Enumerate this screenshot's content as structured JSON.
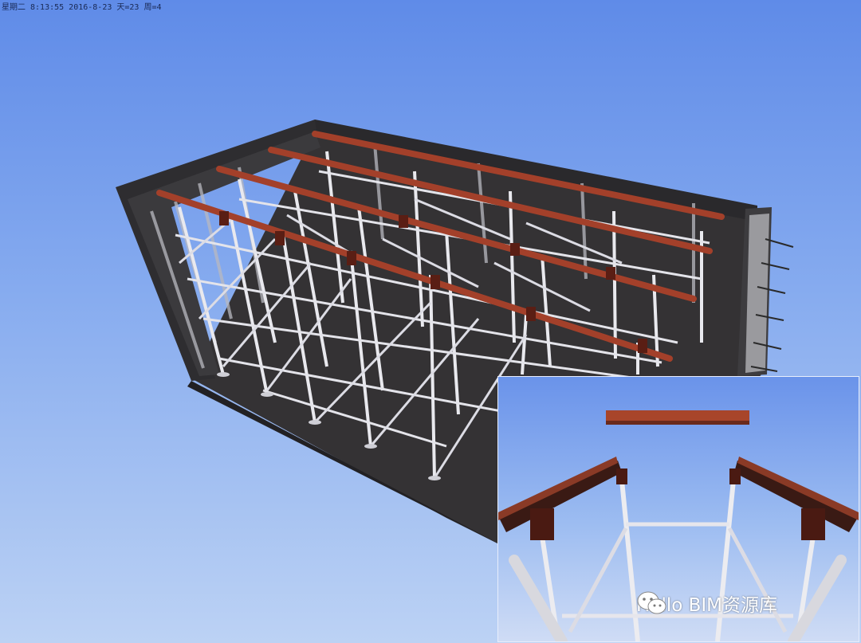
{
  "status_bar": {
    "text": "星期二 8:13:55 2016-8-23 天=23 周=4"
  },
  "watermark": {
    "text": "Hello BIM资源库",
    "icon": "wechat-icon"
  },
  "scene": {
    "main_view": "formwork-scaffold-3d-model",
    "inset_view": "scaffold-closeup-detail"
  },
  "colors": {
    "sky_top": "#5f8be8",
    "sky_bottom": "#bcd2f4",
    "formwork": "#2b2a2b",
    "beam": "#a8452a",
    "scaffold": "#e6e6ea"
  }
}
